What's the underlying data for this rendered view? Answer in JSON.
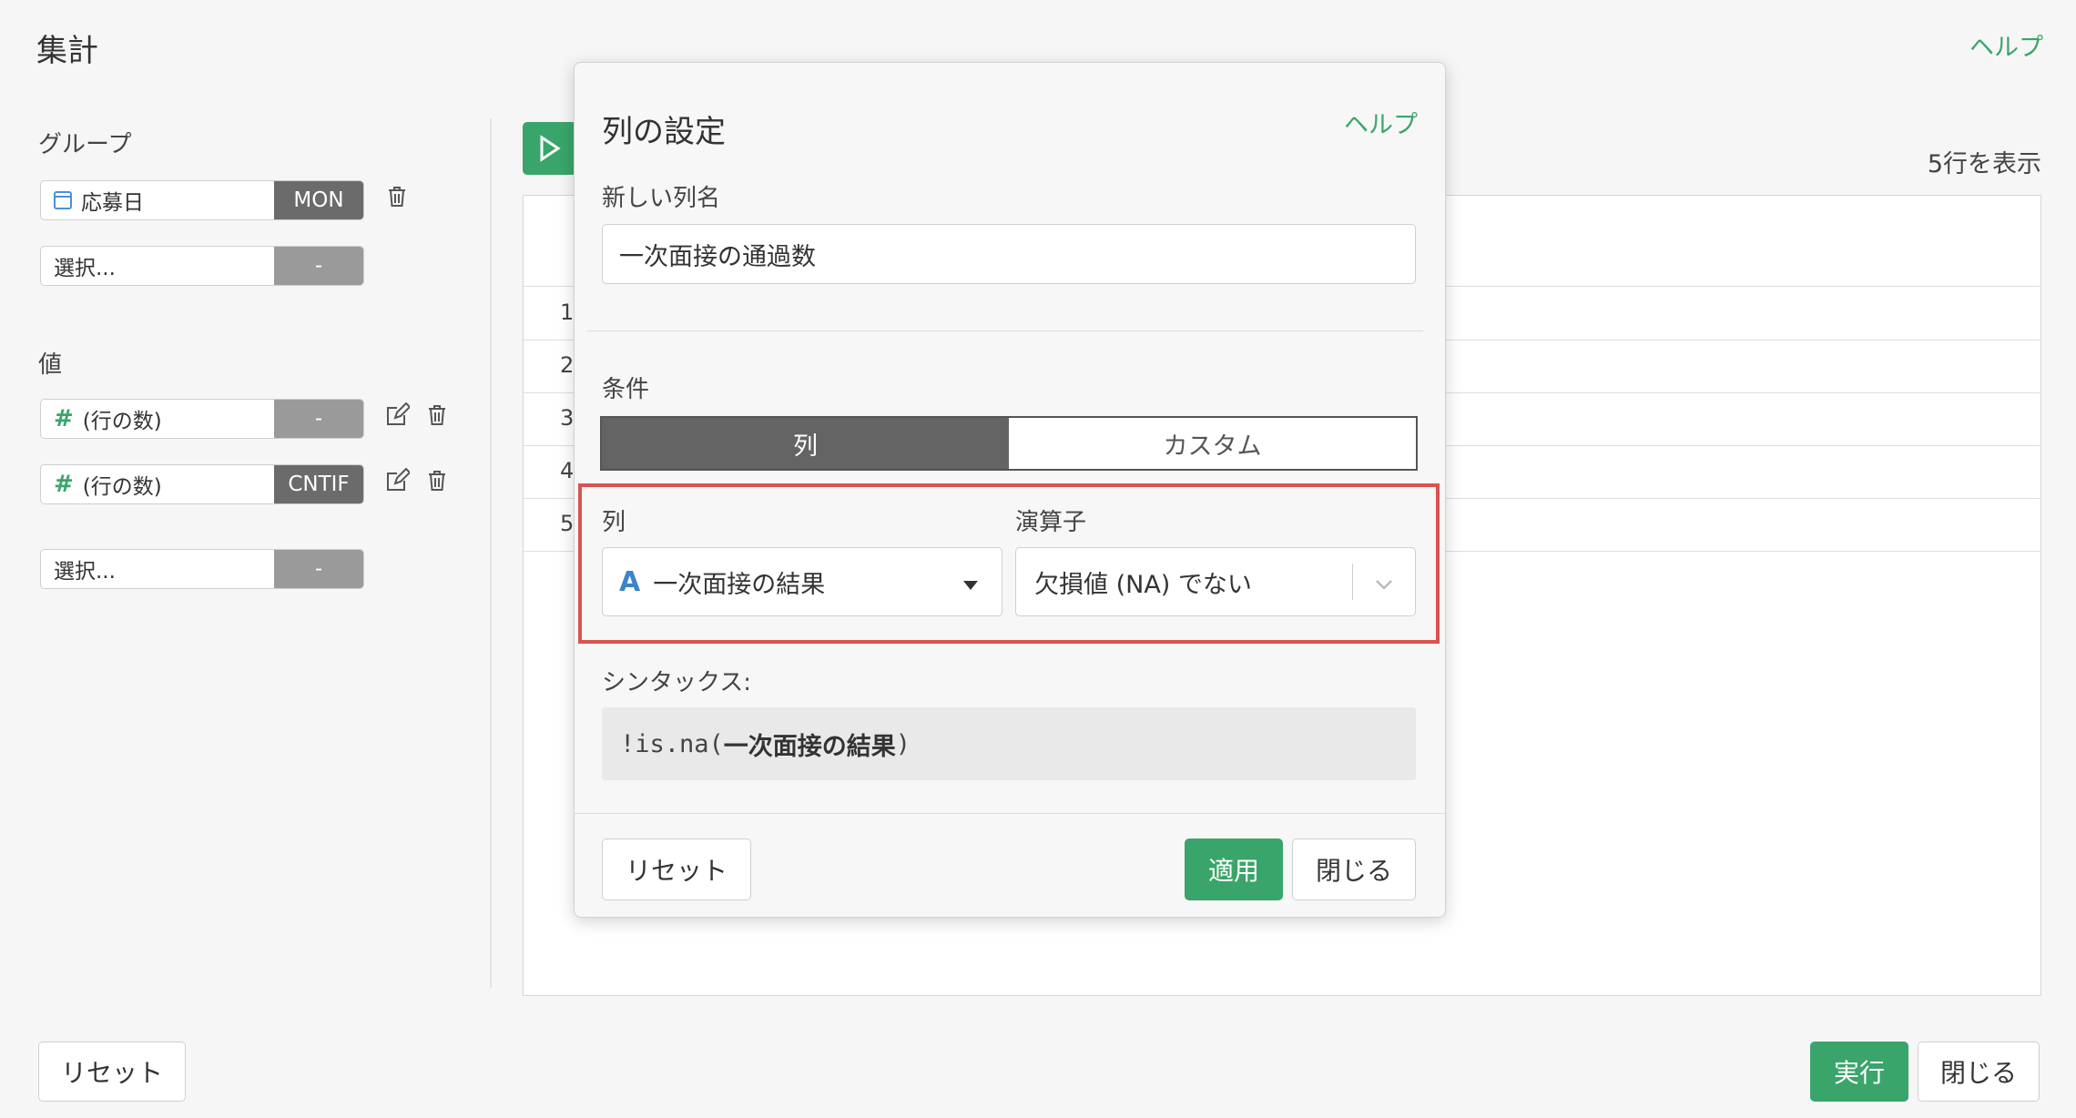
{
  "page": {
    "title": "集計",
    "help": "ヘルプ",
    "rows_count": "5行を表示"
  },
  "left": {
    "group_label": "グループ",
    "group_items": [
      {
        "label": "応募日",
        "tag": "MON"
      },
      {
        "label": "選択...",
        "tag": "-"
      }
    ],
    "value_label": "値",
    "value_items": [
      {
        "label": "(行の数)",
        "tag": "-"
      },
      {
        "label": "(行の数)",
        "tag": "CNTIF"
      },
      {
        "label": "選択...",
        "tag": "-"
      }
    ]
  },
  "table": {
    "row_numbers": [
      "1",
      "2",
      "3",
      "4",
      "5"
    ]
  },
  "bottom": {
    "reset": "リセット",
    "run": "実行",
    "close": "閉じる"
  },
  "modal": {
    "title": "列の設定",
    "help": "ヘルプ",
    "new_name_label": "新しい列名",
    "new_name_value": "一次面接の通過数",
    "condition_label": "条件",
    "tabs": [
      "列",
      "カスタム"
    ],
    "column_label": "列",
    "column_value": "一次面接の結果",
    "column_type_icon": "A",
    "operator_label": "演算子",
    "operator_value": "欠損値 (NA) でない",
    "syntax_label": "シンタックス:",
    "syntax_prefix": "!is.na(",
    "syntax_bold": "一次面接の結果",
    "syntax_suffix": ")",
    "reset": "リセット",
    "apply": "適用",
    "close": "閉じる",
    "colors": {
      "accent": "#3aa56a",
      "highlight": "#d9534f"
    }
  }
}
